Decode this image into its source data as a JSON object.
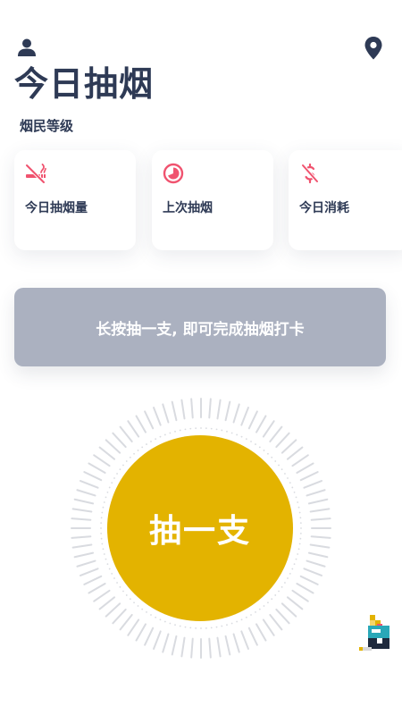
{
  "header": {
    "title": "今日抽烟",
    "level_label": "烟民等级",
    "user_icon": "user-icon",
    "location_icon": "location-pin-icon"
  },
  "cards": [
    {
      "label": "今日抽烟量",
      "icon": "no-smoking-icon"
    },
    {
      "label": "上次抽烟",
      "icon": "clock-icon"
    },
    {
      "label": "今日消耗",
      "icon": "dollar-icon"
    }
  ],
  "checkin": {
    "text": "长按抽一支, 即可完成抽烟打卡"
  },
  "main_button": {
    "label": "抽一支"
  },
  "mascot_icon": "pixel-cigarette-pack-icon",
  "colors": {
    "primary_text": "#2e3a55",
    "accent_pink": "#f0536f",
    "button_yellow": "#e3b300",
    "banner_gray": "#abb1c0",
    "dial_ticks": "#d9dbe0"
  }
}
